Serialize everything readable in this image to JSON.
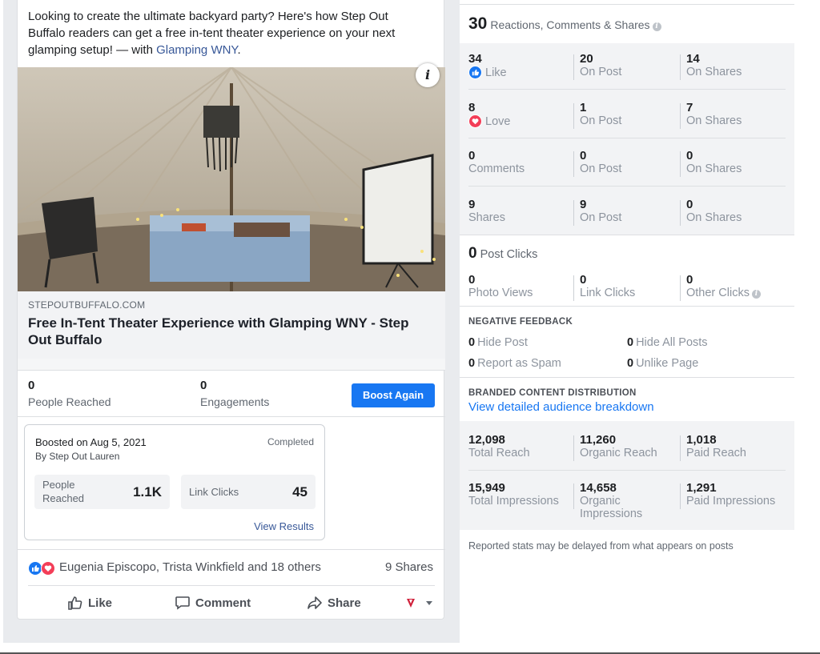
{
  "post": {
    "text_main": "Looking to create the ultimate backyard party? Here's how Step Out Buffalo readers can get a free in-tent theater experience on your next glamping setup! — with ",
    "text_tag": "Glamping WNY",
    "text_end": ".",
    "info_glyph": "i",
    "link_domain": "STEPOUTBUFFALO.COM",
    "link_title": "Free In-Tent Theater Experience with Glamping WNY - Step Out Buffalo"
  },
  "metrics": {
    "people_reached_value": "0",
    "people_reached_label": "People Reached",
    "engagements_value": "0",
    "engagements_label": "Engagements",
    "boost_again_label": "Boost Again"
  },
  "boost_card": {
    "date": "Boosted on Aug 5, 2021",
    "by": "By Step Out Lauren",
    "status": "Completed",
    "people_reached_label": "People Reached",
    "people_reached_value": "1.1K",
    "link_clicks_label": "Link Clicks",
    "link_clicks_value": "45",
    "view_results_label": "View Results"
  },
  "social": {
    "likers": "Eugenia Episcopo, Trista Winkfield and 18 others",
    "shares": "9 Shares",
    "like_label": "Like",
    "comment_label": "Comment",
    "share_label": "Share"
  },
  "insights": {
    "total": "30",
    "total_label": "Reactions, Comments & Shares",
    "rows": [
      [
        {
          "n": "34",
          "l": "Like"
        },
        {
          "n": "20",
          "l": "On Post"
        },
        {
          "n": "14",
          "l": "On Shares"
        }
      ],
      [
        {
          "n": "8",
          "l": "Love"
        },
        {
          "n": "1",
          "l": "On Post"
        },
        {
          "n": "7",
          "l": "On Shares"
        }
      ],
      [
        {
          "n": "0",
          "l": "Comments"
        },
        {
          "n": "0",
          "l": "On Post"
        },
        {
          "n": "0",
          "l": "On Shares"
        }
      ],
      [
        {
          "n": "9",
          "l": "Shares"
        },
        {
          "n": "9",
          "l": "On Post"
        },
        {
          "n": "0",
          "l": "On Shares"
        }
      ]
    ],
    "post_clicks": "0",
    "post_clicks_label": "Post Clicks",
    "clicks": [
      {
        "n": "0",
        "l": "Photo Views"
      },
      {
        "n": "0",
        "l": "Link Clicks"
      },
      {
        "n": "0",
        "l": "Other Clicks"
      }
    ],
    "negative_head": "NEGATIVE FEEDBACK",
    "negative": [
      {
        "n": "0",
        "l": "Hide Post"
      },
      {
        "n": "0",
        "l": "Hide All Posts"
      },
      {
        "n": "0",
        "l": "Report as Spam"
      },
      {
        "n": "0",
        "l": "Unlike Page"
      }
    ],
    "branded_head": "BRANDED CONTENT DISTRIBUTION",
    "audience_link": "View detailed audience breakdown",
    "reach": [
      {
        "n": "12,098",
        "l": "Total Reach"
      },
      {
        "n": "11,260",
        "l": "Organic Reach"
      },
      {
        "n": "1,018",
        "l": "Paid Reach"
      }
    ],
    "impressions": [
      {
        "n": "15,949",
        "l": "Total Impressions"
      },
      {
        "n": "14,658",
        "l1": "Organic",
        "l2": "Impressions"
      },
      {
        "n": "1,291",
        "l": "Paid Impressions"
      }
    ],
    "footnote": "Reported stats may be delayed from what appears on posts"
  },
  "colors": {
    "accent": "#1877f2",
    "like": "#1877f2",
    "love": "#f33e58"
  }
}
